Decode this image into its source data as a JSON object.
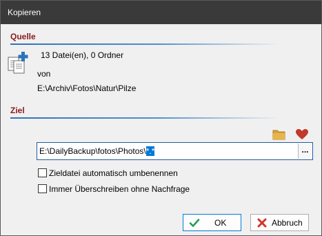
{
  "window": {
    "title": "Kopieren"
  },
  "source": {
    "heading": "Quelle",
    "summary": "13 Datei(en), 0 Ordner",
    "from_label": "von",
    "path": "E:\\Archiv\\Fotos\\Natur\\Pilze"
  },
  "target": {
    "heading": "Ziel",
    "path_prefix": "E:\\DailyBackup\\fotos\\Photos\\",
    "path_selected": "*.*",
    "browse_label": "..."
  },
  "options": {
    "auto_rename": {
      "label": "Zieldatei automatisch umbenennen",
      "checked": false
    },
    "always_overwrite": {
      "label": "Immer Überschreiben ohne Nachfrage",
      "checked": false
    }
  },
  "buttons": {
    "ok_label": "OK",
    "cancel_label": "Abbruch"
  },
  "icons": {
    "copy": "copy-files-icon",
    "folder": "folder-icon",
    "favorite": "heart-icon",
    "ok": "checkmark-icon",
    "cancel": "x-icon"
  },
  "colors": {
    "titlebar": "#3a3a3a",
    "section_heading": "#8b1a1a",
    "accent": "#0078d7",
    "section_line": "#2d73b8",
    "heart": "#c0392b",
    "folder": "#d9a23a",
    "ok_check": "#1f9d55",
    "cancel_x": "#d4352b"
  }
}
